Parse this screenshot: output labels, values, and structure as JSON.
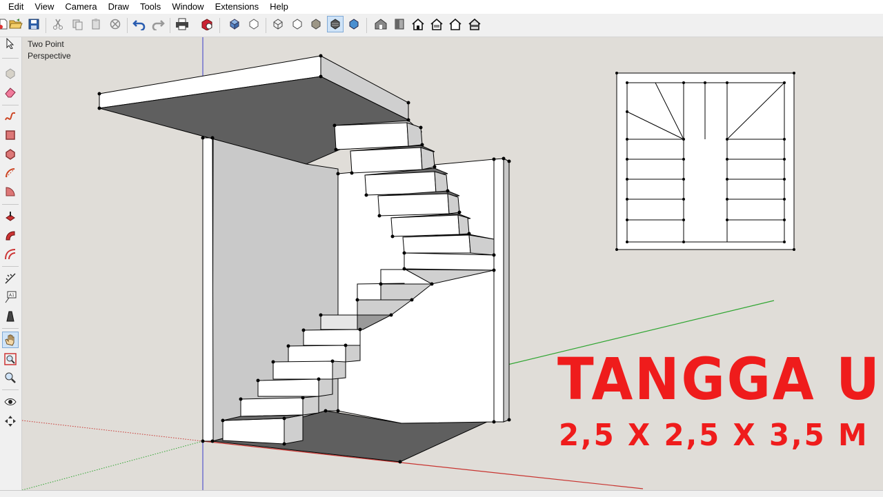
{
  "menu": [
    "Edit",
    "View",
    "Camera",
    "Draw",
    "Tools",
    "Window",
    "Extensions",
    "Help"
  ],
  "toolbar": {
    "icons": [
      "new-icon",
      "open-icon",
      "save-icon",
      "cut-icon",
      "copy-icon",
      "paste-icon",
      "erase-icon",
      "undo-icon",
      "redo-icon",
      "print-icon",
      "model-info-icon",
      "xray-icon",
      "back-edges-icon",
      "wireframe-icon",
      "hidden-line-icon",
      "shaded-icon",
      "shaded-textures-icon",
      "monochrome-icon",
      "iso-view-icon",
      "top-view-icon",
      "front-view-icon",
      "right-view-icon",
      "back-view-icon",
      "left-view-icon"
    ],
    "active": "shaded-textures-icon"
  },
  "left_tools": {
    "icons": [
      "select-icon",
      "component-icon",
      "eraser-icon",
      "freehand-icon",
      "rectangle-icon",
      "polygon-icon",
      "arc-icon",
      "pie-icon",
      "pushpull-icon",
      "followme-icon",
      "offset-icon",
      "tape-measure-icon",
      "text-tool-icon",
      "paint-bucket-icon",
      "pan-hand-icon",
      "zoom-extents-icon",
      "zoom-icon",
      "look-around-icon",
      "walk-icon"
    ],
    "active": "pan-hand-icon"
  },
  "viewport": {
    "camera_label": [
      "Two Point",
      "Perspective"
    ]
  },
  "overlay": {
    "title": "TANGGA U",
    "subtitle": "2,5 X 2,5 X 3,5 M"
  },
  "colors": {
    "viewport_bg": "#e0ddd8",
    "title_red": "#ef1c1c",
    "shadow_face": "#5f5f5f",
    "axis_red": "#c8332f",
    "axis_green": "#2fa531",
    "axis_blue": "#3939c8"
  }
}
